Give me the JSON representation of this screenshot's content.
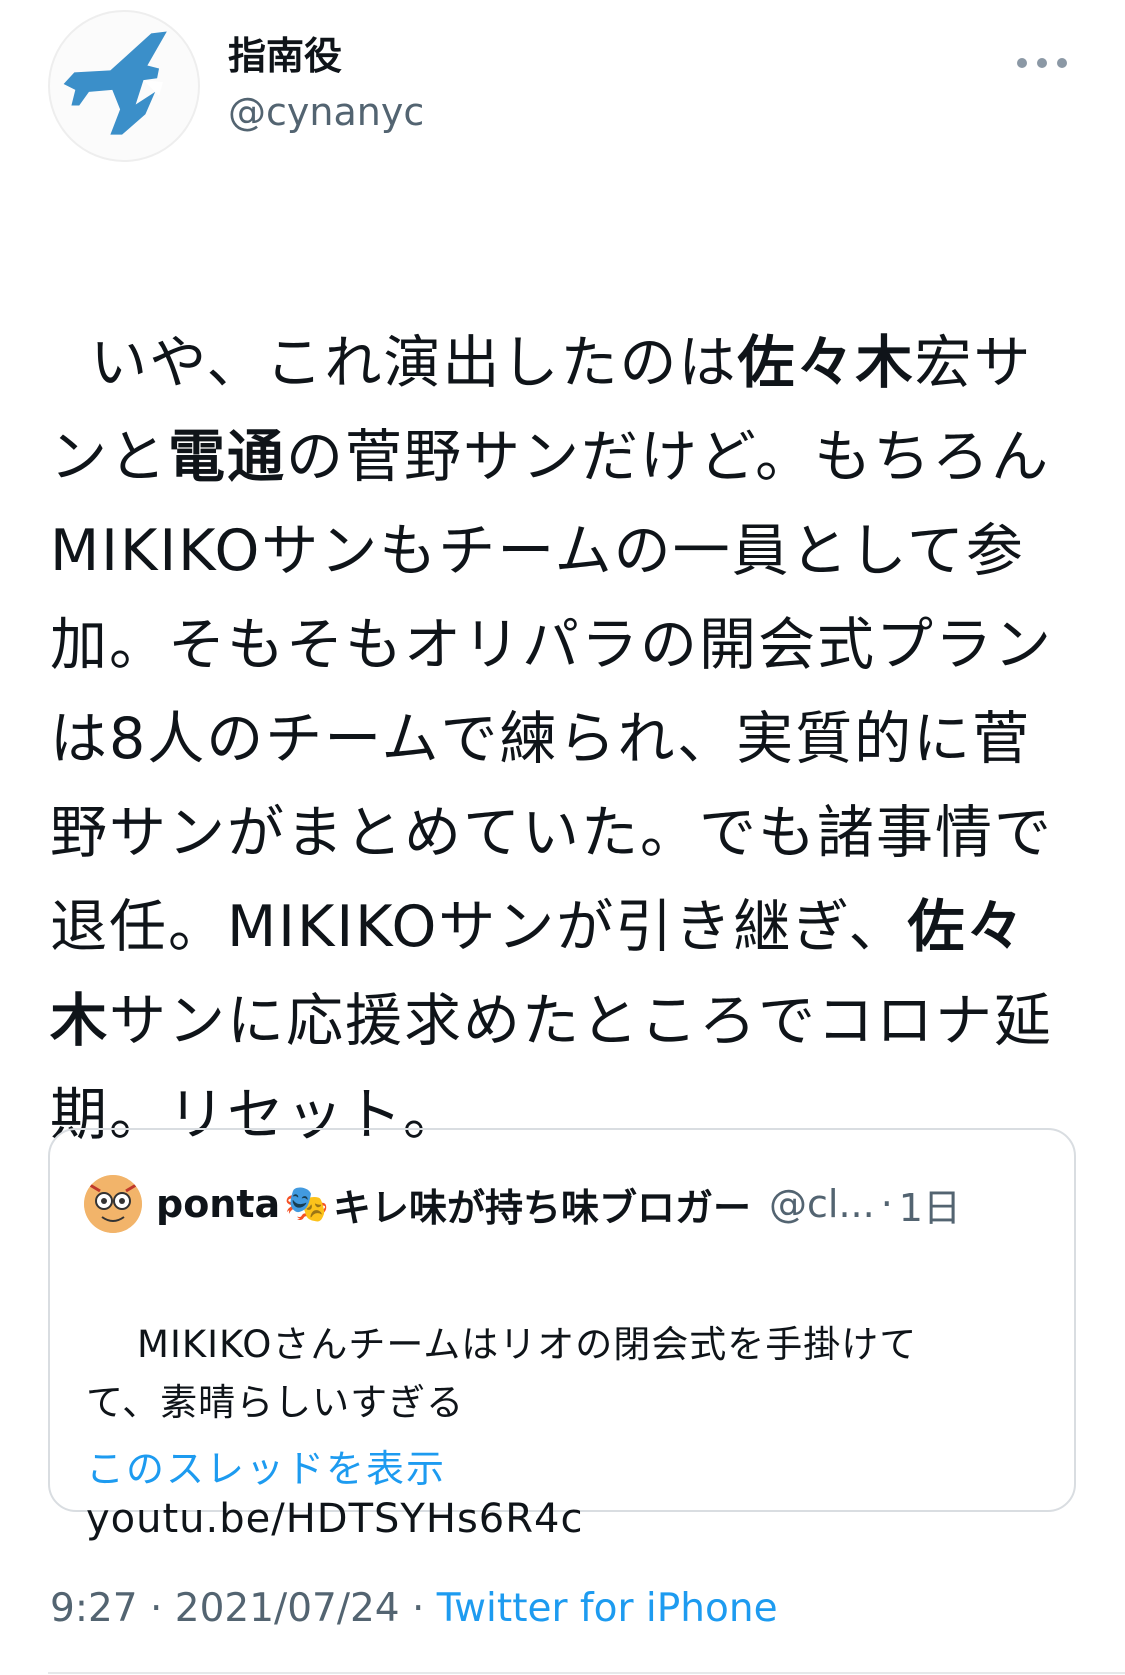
{
  "author": {
    "display_name": "指南役",
    "handle": "@cynanyc",
    "avatar_icon": "airplane-logo-icon",
    "more_icon": "more-options-icon"
  },
  "tweet": {
    "segments": [
      {
        "text": "いや、これ演出したのは",
        "bold": false
      },
      {
        "text": "佐々木",
        "bold": true
      },
      {
        "text": "宏サンと",
        "bold": false
      },
      {
        "text": "電通",
        "bold": true
      },
      {
        "text": "の菅野サンだけど。もちろんMIKIKOサンもチームの一員として参加。そもそもオリパラの開会式プランは8人のチームで練られ、実質的に菅野サンがまとめていた。でも諸事情で退任。MIKIKOサンが引き継ぎ、",
        "bold": false
      },
      {
        "text": "佐々木",
        "bold": true
      },
      {
        "text": "サンに応援求めたところでコロナ延期。リセット。",
        "bold": false
      }
    ]
  },
  "quote": {
    "name": "ponta",
    "emoji": "🎭",
    "name_suffix": "キレ味が持ち味ブロガー",
    "handle": "@cl...",
    "separator": "·",
    "time": "1日",
    "text": "MIKIKOさんチームはリオの閉会式を手掛けて\nて、素晴らしいすぎる",
    "link": "youtu.be/HDTSYHs6R4c",
    "show_thread": "このスレッドを表示",
    "avatar_icon": "cartoon-avatar-icon"
  },
  "meta": {
    "time": "9:27",
    "sep1": " · ",
    "date": "2021/07/24",
    "sep2": " · ",
    "source": "Twitter for iPhone"
  },
  "colors": {
    "link": "#1d9bf0",
    "secondary": "#536471",
    "text": "#0f1419",
    "logo_blue": "#3b8fc9"
  }
}
